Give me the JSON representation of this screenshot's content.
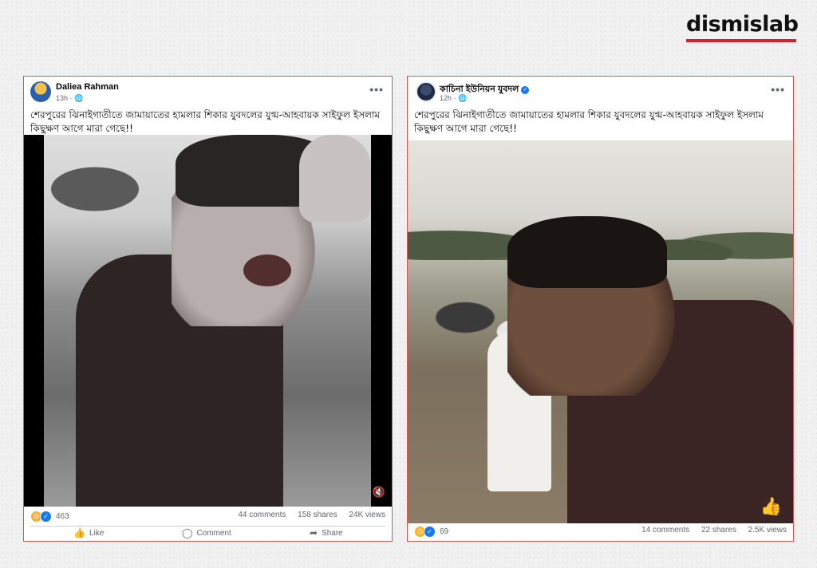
{
  "brand": {
    "name": "dismislab",
    "accent": "#d8222b"
  },
  "posts": [
    {
      "author": "Daliea Rahman",
      "time": "13h",
      "privacy_icon": "globe-icon",
      "caption": "শেরপুরের ঝিনাইগাতীতে জামায়াতের হামলার শিকার যুবদলের যুগ্ম-আহবায়ক সাইফুল ইসলাম কিছুক্ষণ আগে মারা গেছে!!",
      "reaction_count": "463",
      "comments": "44 comments",
      "shares": "158 shares",
      "views": "24K views",
      "actions": {
        "like": "Like",
        "comment": "Comment",
        "share": "Share"
      }
    },
    {
      "author": "কাচিনা ইউনিয়ন যুবদল",
      "verified": true,
      "time": "12h",
      "privacy_icon": "globe-icon",
      "caption": "শেরপুরের ঝিনাইগাতীতে জামায়াতের হামলার শিকার যুবদলের যুগ্ম-আহবায়ক সাইফুল ইসলাম কিছুক্ষণ আগে মারা গেছে!!",
      "reaction_count": "69",
      "comments": "14 comments",
      "shares": "22 shares",
      "views": "2.5K views"
    }
  ]
}
